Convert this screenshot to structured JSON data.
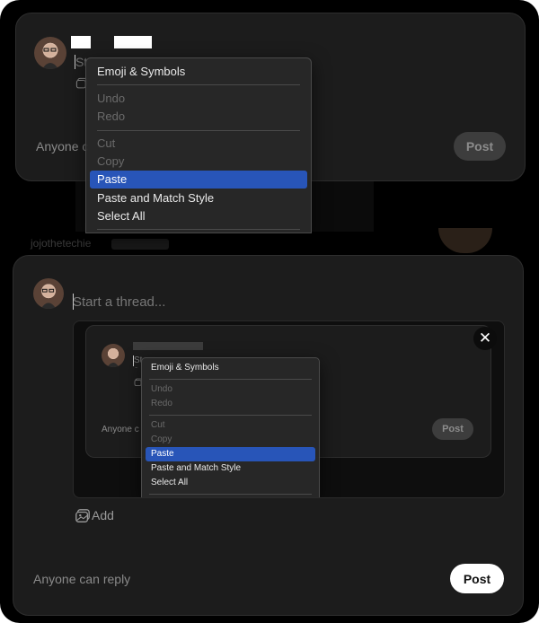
{
  "composer_top": {
    "placeholder": "Start a thread...",
    "reply_setting": "Anyone c",
    "post_label": "Post"
  },
  "menu_top": {
    "items": [
      {
        "label": "Emoji & Symbols",
        "state": "enabled"
      },
      {
        "label": "Undo",
        "state": "disabled"
      },
      {
        "label": "Redo",
        "state": "disabled"
      },
      {
        "label": "Cut",
        "state": "disabled"
      },
      {
        "label": "Copy",
        "state": "disabled"
      },
      {
        "label": "Paste",
        "state": "selected"
      },
      {
        "label": "Paste and Match Style",
        "state": "enabled"
      },
      {
        "label": "Select All",
        "state": "enabled"
      }
    ]
  },
  "background": {
    "username": "jojothetechie"
  },
  "composer_main": {
    "placeholder": "Start a thread...",
    "add_label": "Add",
    "reply_setting": "Anyone can reply",
    "post_label": "Post"
  },
  "attached_image": {
    "close_symbol": "✕",
    "inner_reply_setting": "Anyone c",
    "inner_post_label": "Post",
    "inner_placeholder": "Start a thread..."
  },
  "menu_inner": {
    "items": [
      {
        "label": "Emoji & Symbols",
        "state": "enabled"
      },
      {
        "label": "Undo",
        "state": "disabled"
      },
      {
        "label": "Redo",
        "state": "disabled"
      },
      {
        "label": "Cut",
        "state": "disabled"
      },
      {
        "label": "Copy",
        "state": "disabled"
      },
      {
        "label": "Paste",
        "state": "selected"
      },
      {
        "label": "Paste and Match Style",
        "state": "enabled"
      },
      {
        "label": "Select All",
        "state": "enabled"
      }
    ]
  },
  "icons": {
    "avatar": "user-avatar-icon",
    "media": "photo-gallery-icon",
    "close": "close-icon"
  },
  "colors": {
    "selection": "#2855b8",
    "card": "#1c1c1c",
    "background": "#000000"
  }
}
